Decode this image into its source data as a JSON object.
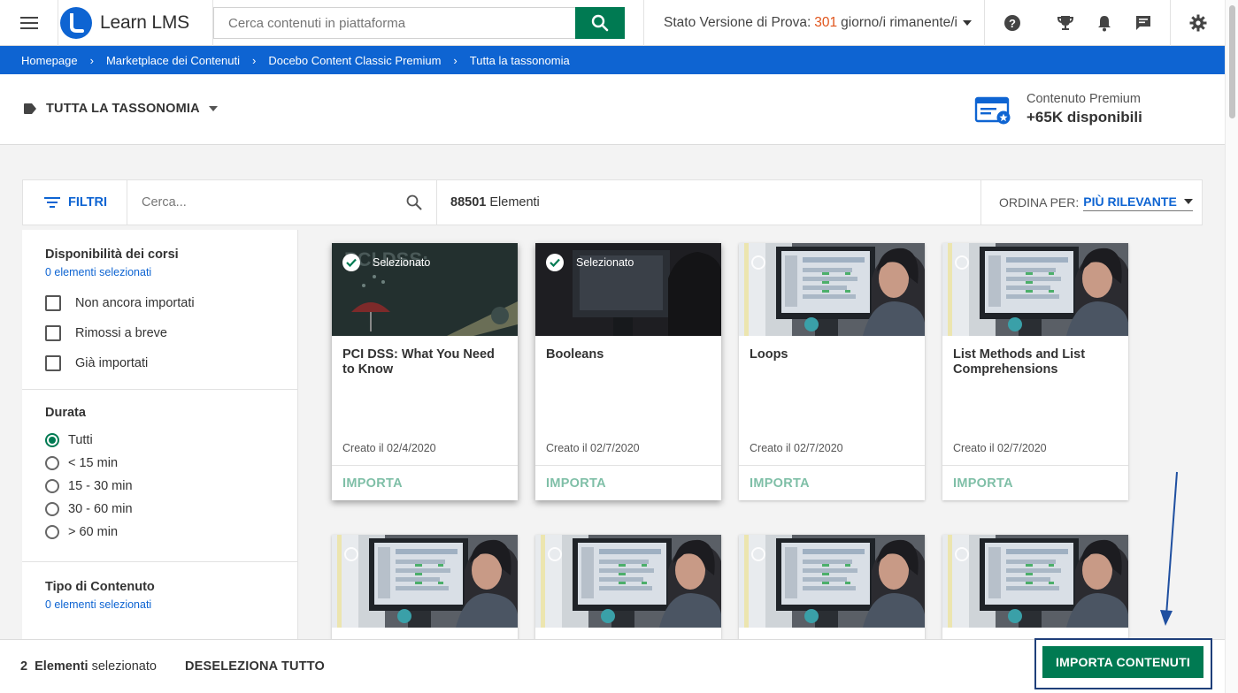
{
  "topbar": {
    "app_name": "Learn LMS",
    "search_placeholder": "Cerca contenuti in piattaforma",
    "trial_prefix": "Stato Versione di Prova:",
    "trial_days": "301",
    "trial_suffix": "giorno/i rimanente/i",
    "icons": [
      "menu-icon",
      "search-icon",
      "help-icon",
      "trophy-icon",
      "bell-icon",
      "chat-icon",
      "gear-icon"
    ],
    "colors": {
      "brand_blue": "#0e64d2",
      "action_green": "#007a52",
      "trial_days_orange": "#e0541b"
    }
  },
  "breadcrumb": [
    "Homepage",
    "Marketplace dei Contenuti",
    "Docebo Content Classic Premium",
    "Tutta la tassonomia"
  ],
  "header": {
    "taxonomy_label": "TUTTA LA TASSONOMIA",
    "premium_line1": "Contenuto Premium",
    "premium_line2": "+65K disponibili"
  },
  "toolbar": {
    "filters_label": "FILTRI",
    "search_placeholder": "Cerca...",
    "count_number": "88501",
    "count_label": "Elementi",
    "sort_prefix": "ORDINA PER:",
    "sort_value": "PIÙ RILEVANTE"
  },
  "filters": {
    "availability": {
      "title": "Disponibilità dei corsi",
      "selected": "0 elementi selezionati",
      "options": [
        "Non ancora importati",
        "Rimossi a breve",
        "Già importati"
      ]
    },
    "duration": {
      "title": "Durata",
      "options": [
        "Tutti",
        "< 15 min",
        "15 - 30 min",
        "30 - 60 min",
        "> 60 min"
      ],
      "selected_option": "Tutti"
    },
    "content_type": {
      "title": "Tipo di Contenuto",
      "selected": "0 elementi selezionati"
    }
  },
  "cards": [
    {
      "title": "PCI DSS: What You Need to Know",
      "date": "Creato il 02/4/2020",
      "selected": true,
      "selected_label": "Selezionato",
      "action": "IMPORTA"
    },
    {
      "title": "Booleans",
      "date": "Creato il 02/7/2020",
      "selected": true,
      "selected_label": "Selezionato",
      "action": "IMPORTA"
    },
    {
      "title": "Loops",
      "date": "Creato il 02/7/2020",
      "selected": false,
      "action": "IMPORTA"
    },
    {
      "title": "List Methods and List Comprehensions",
      "date": "Creato il 02/7/2020",
      "selected": false,
      "action": "IMPORTA"
    }
  ],
  "bottom": {
    "selected_count": "2",
    "selected_label_bold": "Elementi",
    "selected_label": "selezionato",
    "deselect_all": "DESELEZIONA TUTTO",
    "import_button": "IMPORTA CONTENUTI"
  }
}
